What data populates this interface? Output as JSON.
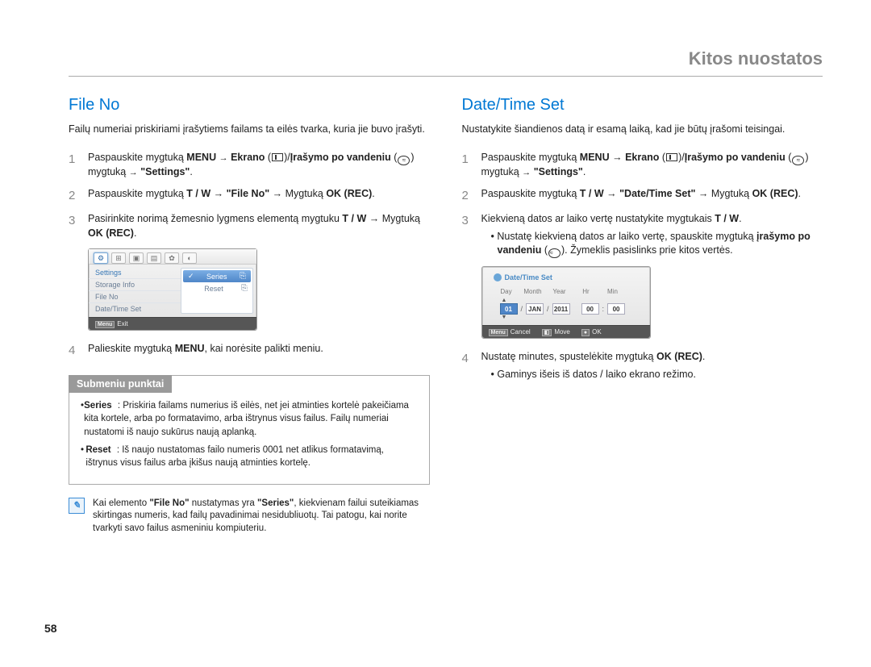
{
  "chapterTitle": "Kitos nuostatos",
  "pageNumber": "58",
  "left": {
    "heading": "File No",
    "intro": "Failų numeriai priskiriami įrašytiems failams ta eilės tvarka, kuria jie buvo įrašyti.",
    "step1_a": "Paspauskite mygtuką ",
    "step1_menu": "MENU",
    "step1_b": " ",
    "step1_arrow1": "→",
    "step1_ekrano": " Ekrano",
    "step1_paren_open": " (",
    "step1_paren_mid": ")/",
    "step1_irasymo": "Įrašymo po vandeniu",
    "step1_paren2_open": " (",
    "step1_c": ") mygtuką ",
    "step1_arrow2": "→",
    "step1_settings": " \"Settings\"",
    "step1_end": ".",
    "step2_a": "Paspauskite mygtuką ",
    "step2_tw": "T / W",
    "step2_arrow1": " → ",
    "step2_fileno": "\"File No\"",
    "step2_arrow2": " → ",
    "step2_mygt": "Mygtuką ",
    "step2_okrec": "OK (REC)",
    "step2_end": ".",
    "step3_a": "Pasirinkite norimą žemesnio lygmens elementą mygtuku ",
    "step3_tw": "T / W",
    "step3_arrow": " → ",
    "step3_mygt": "Mygtuką ",
    "step3_okrec": "OK (REC)",
    "step3_end": ".",
    "step4_a": "Palieskite mygtuką ",
    "step4_menu": "MENU",
    "step4_b": ", kai norėsite palikti meniu.",
    "submenuHeader": "Submeniu punktai",
    "series_label": "Series",
    "series_desc": " : Priskiria failams numerius iš eilės, net jei atminties kortelė pakeičiama kita kortele, arba po formatavimo, arba ištrynus visus failus. Failų numeriai nustatomi iš naujo sukūrus naują aplanką.",
    "reset_label": "Reset",
    "reset_desc": " : Iš naujo nustatomas failo numeris 0001 net atlikus formatavimą, ištrynus visus failus arba įkišus naują atminties kortelę.",
    "note_a": "Kai elemento ",
    "note_fileno": "\"File No\"",
    "note_b": " nustatymas yra ",
    "note_series": "\"Series\"",
    "note_c": ", kiekvienam failui suteikiamas skirtingas numeris, kad failų pavadinimai nesidubliuotų. Tai patogu, kai norite tvarkyti savo failus asmeniniu kompiuteriu.",
    "ui": {
      "settings": "Settings",
      "storage": "Storage Info",
      "fileno": "File No",
      "datetime": "Date/Time Set",
      "optSeries": "Series",
      "optReset": "Reset",
      "exit": "Exit",
      "menu": "Menu"
    }
  },
  "right": {
    "heading": "Date/Time Set",
    "intro": "Nustatykite šiandienos datą ir esamą laiką, kad jie būtų įrašomi teisingai.",
    "step1_a": "Paspauskite mygtuką ",
    "step1_menu": "MENU",
    "step1_arrow1": " → ",
    "step1_ekrano": "Ekrano",
    "step1_paren_open": " (",
    "step1_paren_mid": ")/",
    "step1_irasymo": "Įrašymo po vandeniu",
    "step1_paren2_open": " (",
    "step1_c": ") mygtuką ",
    "step1_arrow2": "→",
    "step1_settings": " \"Settings\"",
    "step1_end": ".",
    "step2_a": "Paspauskite mygtuką ",
    "step2_tw": "T / W",
    "step2_arrow1": " → ",
    "step2_dts": "\"Date/Time Set\"",
    "step2_arrow2": " → ",
    "step2_mygt": "Mygtuką ",
    "step2_okrec": "OK (REC)",
    "step2_end": ".",
    "step3_a": "Kiekvieną datos ar laiko vertę nustatykite mygtukais ",
    "step3_tw": "T / W",
    "step3_end": ".",
    "step3_sub_a": "Nustatę kiekvieną datos ar laiko vertę, spauskite mygtuką ",
    "step3_sub_ir": "įrašymo po vandeniu",
    "step3_sub_paren_open": " (",
    "step3_sub_b": "). Žymeklis pasislinks prie kitos vertės.",
    "step4_a": "Nustatę minutes, spustelėkite mygtuką ",
    "step4_okrec": "OK (REC)",
    "step4_end": ".",
    "step4_sub": "Gaminys išeis iš datos / laiko ekrano režimo.",
    "ui": {
      "title": "Date/Time Set",
      "day": "Day",
      "month": "Month",
      "year": "Year",
      "hr": "Hr",
      "min": "Min",
      "vDay": "01",
      "vMonth": "JAN",
      "vYear": "2011",
      "vHr": "00",
      "vMin": "00",
      "cancel": "Cancel",
      "move": "Move",
      "ok": "OK",
      "menu": "Menu"
    }
  }
}
